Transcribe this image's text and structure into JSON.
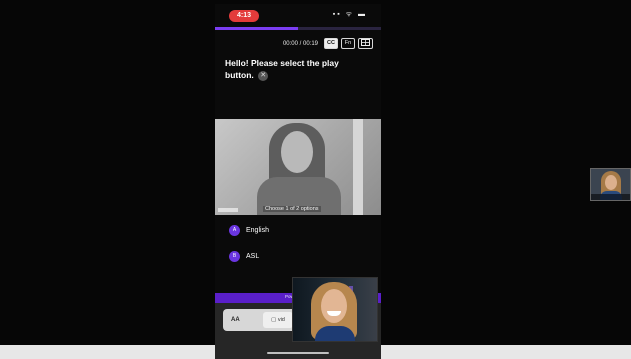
{
  "status_bar": {
    "time": "4:13",
    "icons": "▪▪ ᯤ ▬"
  },
  "playback": {
    "progress_fraction": 0.5
  },
  "controls": {
    "time_readout": "00:00 / 00:19",
    "cc_label": "CC",
    "lang_label": "Fn",
    "expand_icon": "expand-icon"
  },
  "prompt": {
    "text": "Hello! Please select the play button.",
    "close_icon": "close-icon"
  },
  "video": {
    "caption": "Choose 1 of 2 options"
  },
  "options": [
    {
      "badge": "A",
      "label": "English"
    },
    {
      "badge": "B",
      "label": "ASL"
    }
  ],
  "footer": {
    "powered_by": "Powered by",
    "text_size_label": "AA",
    "video_button_label": "▢ vid"
  },
  "colors": {
    "accent": "#7b3df2",
    "band": "#5a1fc9",
    "status_pill": "#e33b3b",
    "background": "#060606"
  }
}
